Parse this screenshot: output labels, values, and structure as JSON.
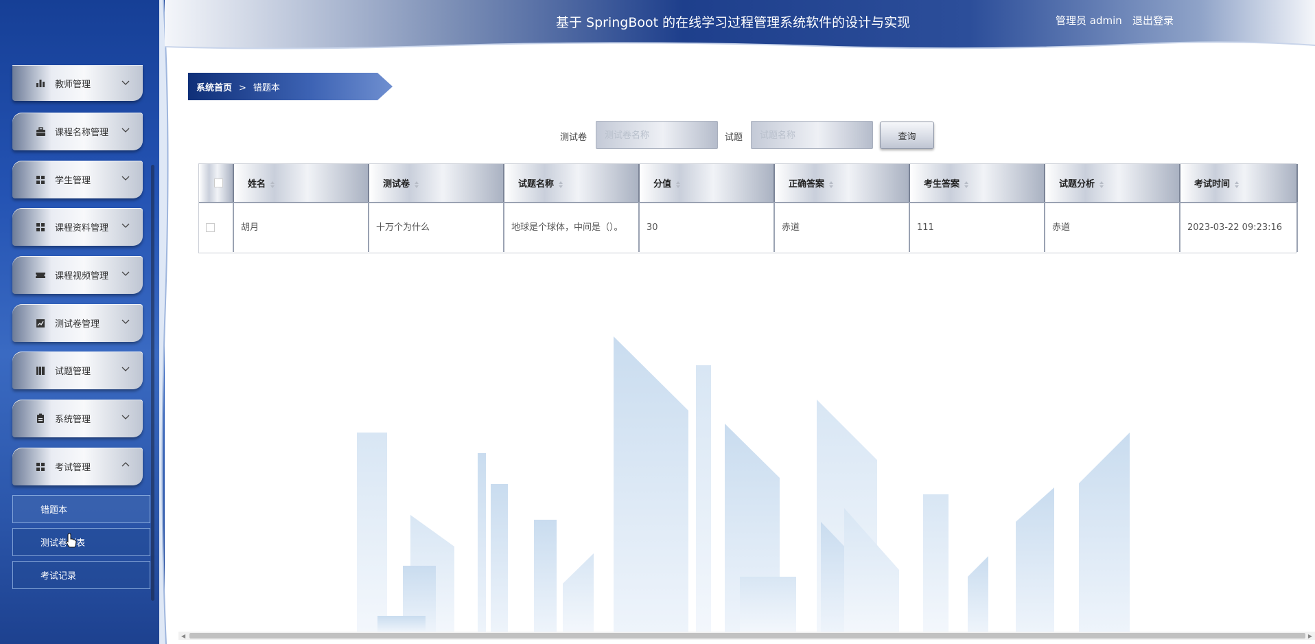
{
  "header": {
    "title": "基于 SpringBoot 的在线学习过程管理系统软件的设计与实现",
    "user": "管理员 admin",
    "logout": "退出登录"
  },
  "sidebar": {
    "items": [
      {
        "label": "教师管理",
        "icon": "bar-chart-icon",
        "expanded": false
      },
      {
        "label": "课程名称管理",
        "icon": "briefcase-icon",
        "expanded": false
      },
      {
        "label": "学生管理",
        "icon": "grid-icon",
        "expanded": false
      },
      {
        "label": "课程资料管理",
        "icon": "grid-icon",
        "expanded": false
      },
      {
        "label": "课程视频管理",
        "icon": "ticket-icon",
        "expanded": false
      },
      {
        "label": "测试卷管理",
        "icon": "line-chart-icon",
        "expanded": false
      },
      {
        "label": "试题管理",
        "icon": "book-icon",
        "expanded": false
      },
      {
        "label": "系统管理",
        "icon": "clipboard-icon",
        "expanded": false
      },
      {
        "label": "考试管理",
        "icon": "grid-icon",
        "expanded": true
      }
    ],
    "subitems": [
      {
        "label": "错题本"
      },
      {
        "label": "测试卷列表"
      },
      {
        "label": "考试记录"
      }
    ]
  },
  "breadcrumb": {
    "home": "系统首页",
    "separator": ">",
    "current": "错题本"
  },
  "search": {
    "paper_label": "测试卷",
    "paper_placeholder": "测试卷名称",
    "question_label": "试题",
    "question_placeholder": "试题名称",
    "button": "查询"
  },
  "table": {
    "columns": [
      "姓名",
      "测试卷",
      "试题名称",
      "分值",
      "正确答案",
      "考生答案",
      "试题分析",
      "考试时间"
    ],
    "rows": [
      {
        "name": "胡月",
        "paper": "十万个为什么",
        "question": "地球是个球体，中间是（）。",
        "score": "30",
        "correct": "赤道",
        "answer": "111",
        "analysis": "赤道",
        "time": "2023-03-22 09:23:16"
      }
    ]
  },
  "colors": {
    "sidebar": "#2453b3",
    "header_dark": "#1b3f8e",
    "breadcrumb": "#1d3f8a"
  }
}
